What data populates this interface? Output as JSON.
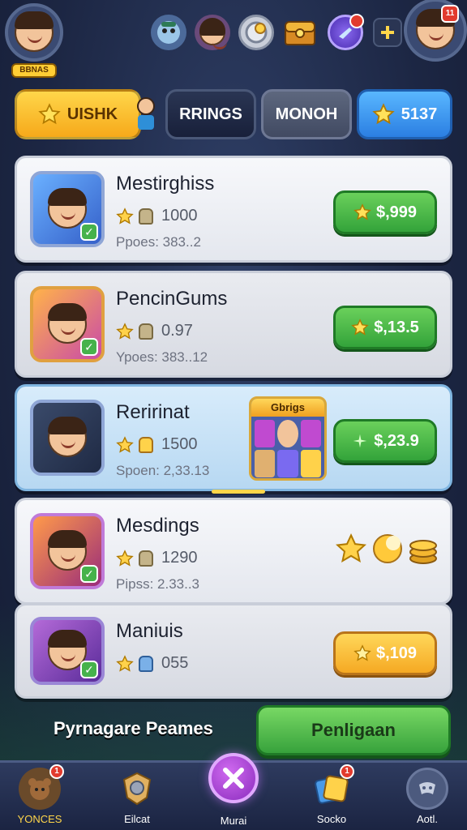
{
  "header": {
    "player_badge": "BBNAS",
    "top_notification": "11"
  },
  "tabs": [
    {
      "label": "UISHK",
      "style": "yellow"
    },
    {
      "label": "RRINGS",
      "style": "dark"
    },
    {
      "label": "MONOH",
      "style": "grey"
    },
    {
      "label": "5137",
      "style": "blue"
    }
  ],
  "items": [
    {
      "name": "Mestirghiss",
      "stat": "1000",
      "sub": "Ppoes: 383..2",
      "price": "$,999",
      "button_style": "green",
      "icon": "star"
    },
    {
      "name": "PencinGums",
      "stat": "0.97",
      "sub": "Ypoes: 383..12",
      "price": "$,13.5",
      "button_style": "green",
      "icon": "star"
    },
    {
      "name": "Reririnat",
      "stat": "1500",
      "sub": "Spoen: 2,33.13",
      "price": "$,23.9",
      "button_style": "green",
      "icon": "plus",
      "bundle_label": "Gbrigs"
    },
    {
      "name": "Mesdings",
      "stat": "1290",
      "sub": "Pipss: 2.33..3",
      "price": "",
      "button_style": "none",
      "icon": "none"
    },
    {
      "name": "Maniuis",
      "stat": "055",
      "sub": "",
      "price": "$,109",
      "button_style": "gold",
      "icon": "star"
    }
  ],
  "footer": {
    "label": "Pyrnagare Peames",
    "button": "Penligaan"
  },
  "bottom_nav": [
    {
      "label": "YONCES",
      "badge": "1"
    },
    {
      "label": "Eilcat",
      "badge": ""
    },
    {
      "label": "Murai",
      "badge": ""
    },
    {
      "label": "Socko",
      "badge": "1"
    },
    {
      "label": "Aotl.",
      "badge": ""
    }
  ],
  "colors": {
    "accent_green": "#33a33a",
    "accent_gold": "#f5a923",
    "accent_blue": "#2b7fe2",
    "bg": "#1e2a47"
  }
}
